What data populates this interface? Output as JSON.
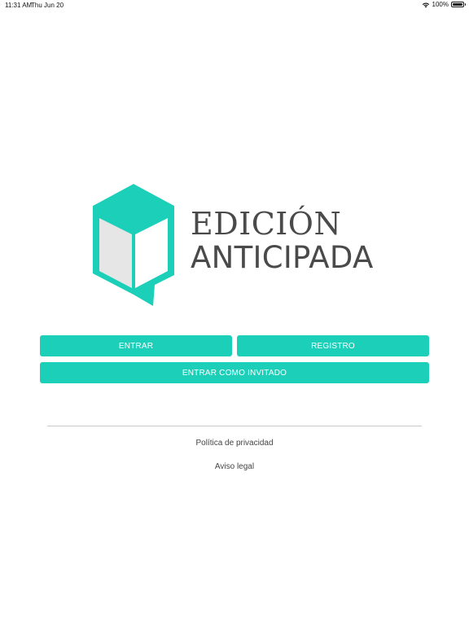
{
  "status_bar": {
    "time": "11:31 AM",
    "date": "Thu Jun 20",
    "battery": "100%",
    "battery_level": 1.0,
    "icons": [
      "wifi-icon",
      "battery-icon"
    ]
  },
  "brand": {
    "line1": "EDICIÓN",
    "line2": "ANTICIPADA",
    "accent_color": "#1ccfb9",
    "text_color": "#4a4a4a"
  },
  "actions": {
    "login_label": "ENTRAR",
    "register_label": "REGISTRO",
    "guest_label": "ENTRAR COMO INVITADO"
  },
  "footer": {
    "privacy_label": "Política de privacidad",
    "legal_label": "Aviso legal"
  }
}
